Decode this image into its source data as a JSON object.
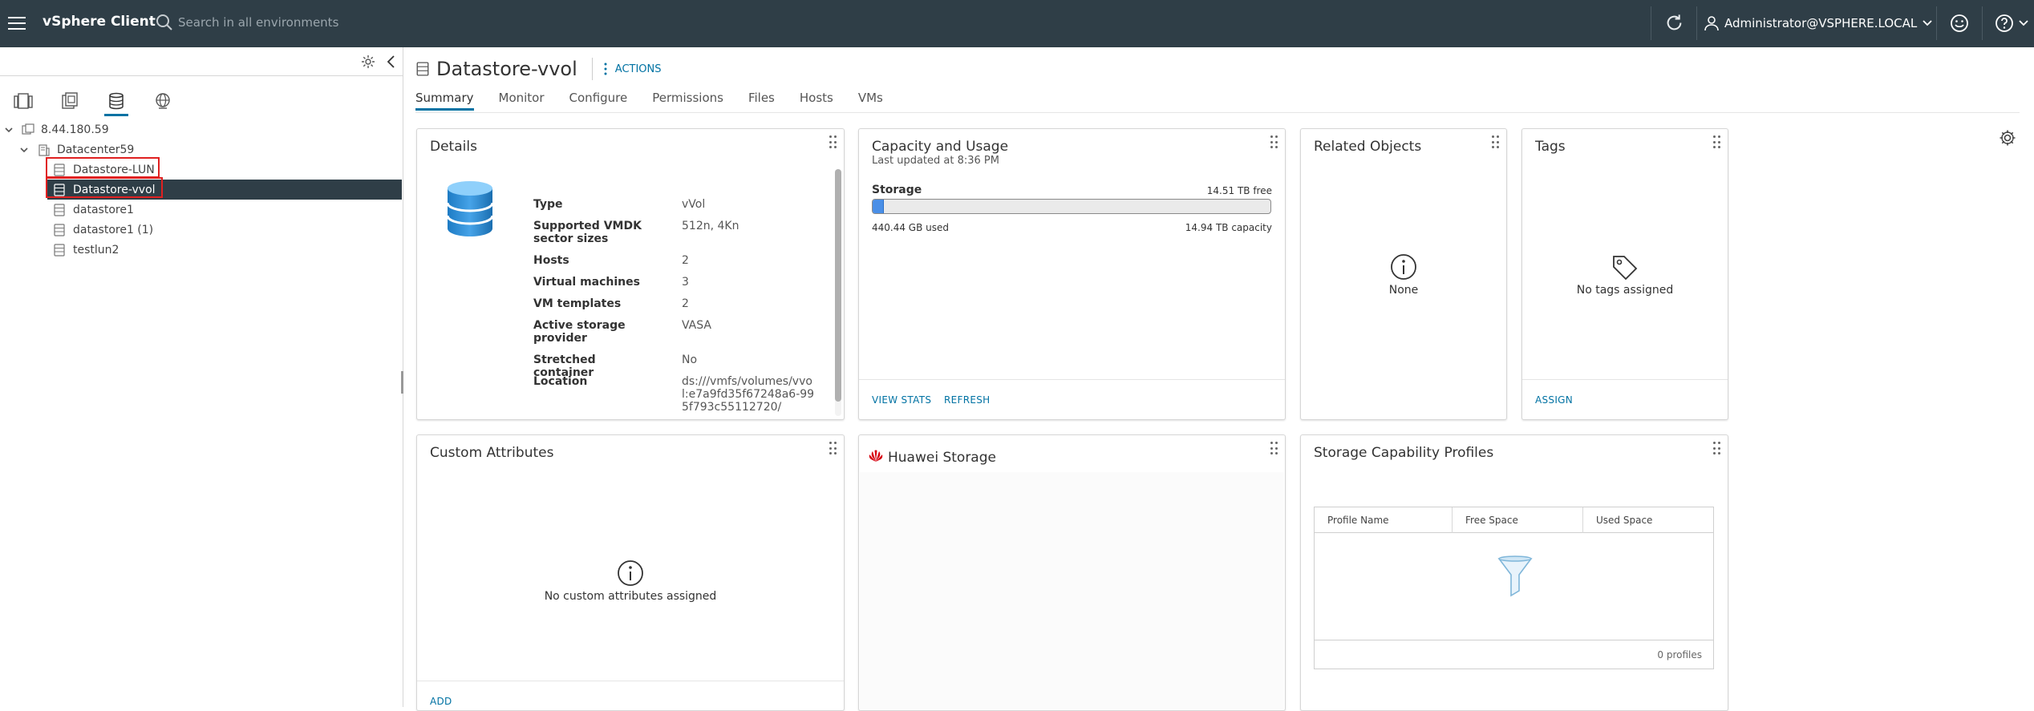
{
  "topbar": {
    "app_title": "vSphere Client",
    "search_placeholder": "Search in all environments",
    "user": "Administrator@VSPHERE.LOCAL"
  },
  "navigator": {
    "tree": [
      {
        "label": "8.44.180.59",
        "level": 0,
        "icon": "vcenter-icon"
      },
      {
        "label": "Datacenter59",
        "level": 1,
        "icon": "datacenter-icon"
      },
      {
        "label": "Datastore-LUN",
        "level": 2,
        "icon": "datastore-icon"
      },
      {
        "label": "Datastore-vvol",
        "level": 2,
        "icon": "datastore-icon",
        "selected": true
      },
      {
        "label": "datastore1",
        "level": 2,
        "icon": "datastore-icon"
      },
      {
        "label": "datastore1 (1)",
        "level": 2,
        "icon": "datastore-icon"
      },
      {
        "label": "testlun2",
        "level": 2,
        "icon": "datastore-icon"
      }
    ]
  },
  "object": {
    "title": "Datastore-vvol",
    "actions_label": "ACTIONS",
    "tabs": [
      "Summary",
      "Monitor",
      "Configure",
      "Permissions",
      "Files",
      "Hosts",
      "VMs"
    ],
    "active_tab": "Summary"
  },
  "details": {
    "title": "Details",
    "rows": [
      {
        "label": "Type",
        "value": "vVol"
      },
      {
        "label": "Supported VMDK sector sizes",
        "value": "512n, 4Kn"
      },
      {
        "label": "Hosts",
        "value": "2"
      },
      {
        "label": "Virtual machines",
        "value": "3"
      },
      {
        "label": "VM templates",
        "value": "2"
      },
      {
        "label": "Active storage provider",
        "value": "VASA"
      },
      {
        "label": "Stretched container",
        "value": "No"
      },
      {
        "label": "Location",
        "value": "ds:///vmfs/volumes/vvol:e7a9fd35f67248a6-995f793c55112720/"
      }
    ]
  },
  "capacity": {
    "title": "Capacity and Usage",
    "updated": "Last updated at 8:36 PM",
    "storage_label": "Storage",
    "free": "14.51 TB free",
    "used": "440.44 GB used",
    "capacity": "14.94 TB capacity",
    "used_fraction": 0.029,
    "view_stats": "VIEW STATS",
    "refresh": "REFRESH"
  },
  "related": {
    "title": "Related Objects",
    "empty": "None"
  },
  "tags": {
    "title": "Tags",
    "empty": "No tags assigned",
    "assign": "ASSIGN"
  },
  "custom_attributes": {
    "title": "Custom Attributes",
    "empty": "No custom attributes assigned",
    "add": "ADD"
  },
  "huawei": {
    "title": "Huawei Storage",
    "brand_color": "#d7000f"
  },
  "profiles": {
    "title": "Storage Capability Profiles",
    "columns": [
      "Profile Name",
      "Free Space",
      "Used Space"
    ],
    "count": "0 profiles"
  },
  "colors": {
    "topbar": "#2f3e47",
    "accent": "#0072a3",
    "highlight": "#e02020"
  }
}
